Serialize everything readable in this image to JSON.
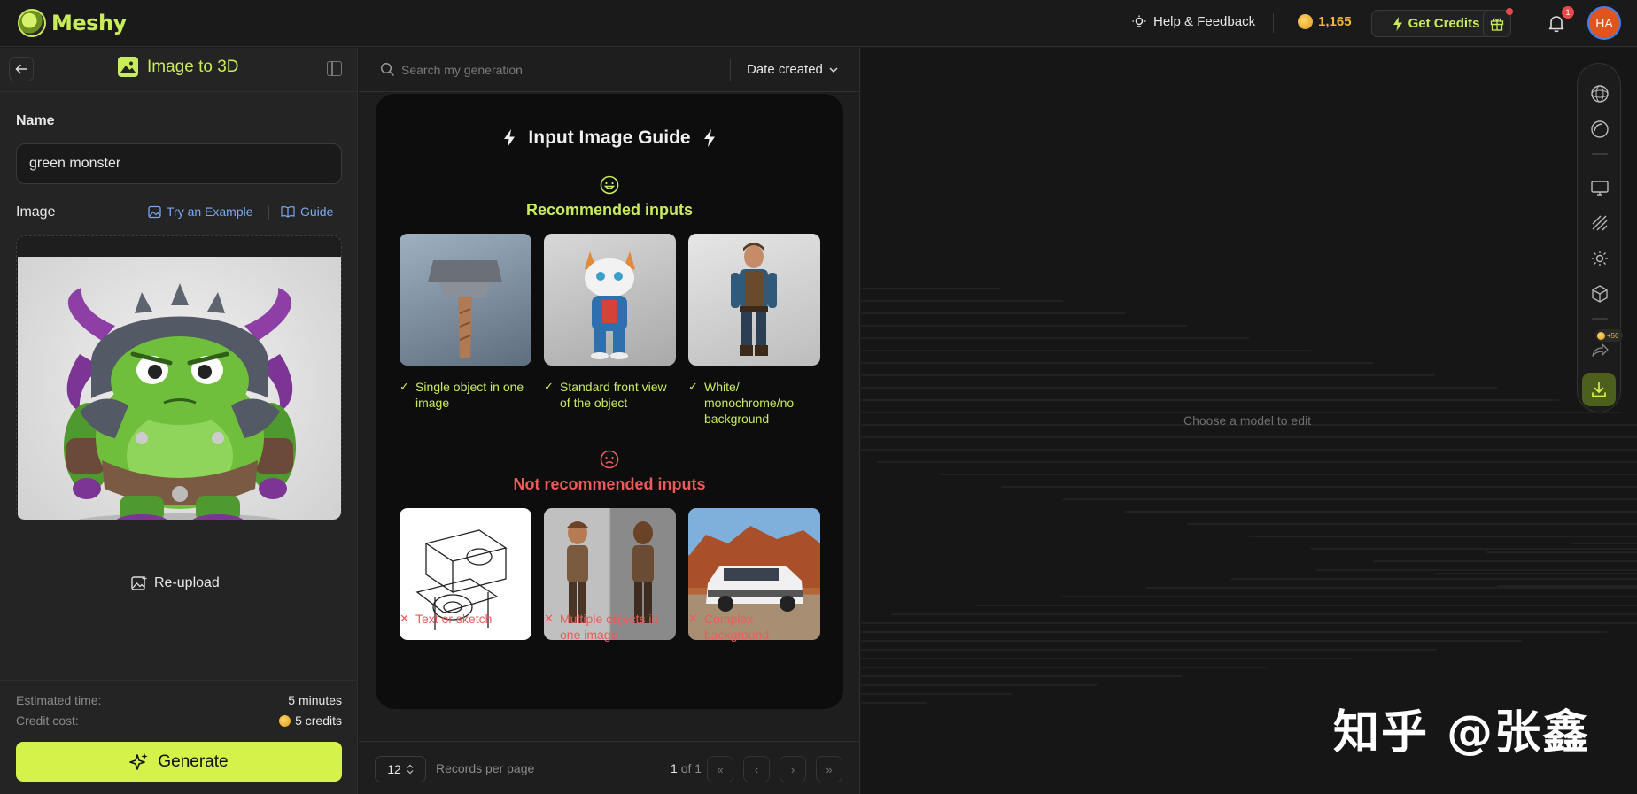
{
  "topbar": {
    "logo_text": "Meshy",
    "help_label": "Help & Feedback",
    "credits": "1,165",
    "get_credits_label": "Get Credits",
    "notification_count": "1",
    "avatar_initials": "HA"
  },
  "left_panel": {
    "title": "Image to 3D",
    "name_label": "Name",
    "name_value": "green monster",
    "image_label": "Image",
    "try_example_label": "Try an Example",
    "guide_label": "Guide",
    "reupload_label": "Re-upload",
    "estimated_time_label": "Estimated time:",
    "estimated_time_value": "5 minutes",
    "credit_cost_label": "Credit cost:",
    "credit_cost_value": "5 credits",
    "generate_label": "Generate"
  },
  "middle_panel": {
    "search_placeholder": "Search my generation",
    "sort_label": "Date created",
    "guide": {
      "title": "Input Image Guide",
      "recommended_title": "Recommended inputs",
      "recommended": [
        {
          "caption": "Single object in one image",
          "thumb": "hammer"
        },
        {
          "caption": "Standard front view of the object",
          "thumb": "cat-character"
        },
        {
          "caption": "White/ monochrome/no background",
          "thumb": "man-character"
        }
      ],
      "not_recommended_title": "Not recommended inputs",
      "not_recommended": [
        {
          "caption": "Text or sketch",
          "thumb": "sketch"
        },
        {
          "caption": "Multiple objects in one image",
          "thumb": "two-views"
        },
        {
          "caption": "Complex background",
          "thumb": "suv-desert"
        }
      ]
    },
    "pager": {
      "per_page": "12",
      "per_page_label": "Records per page",
      "current_page": "1",
      "of_label": "of 1"
    }
  },
  "viewport": {
    "hint": "Choose a model to edit",
    "reward_badge": "+50",
    "watermark": "知乎 @张鑫"
  },
  "colors": {
    "accent": "#c9ec5b",
    "generate_bg": "#d4f24a",
    "error": "#ee5a5a",
    "link": "#7aa7f0",
    "credits": "#f0b53a"
  }
}
